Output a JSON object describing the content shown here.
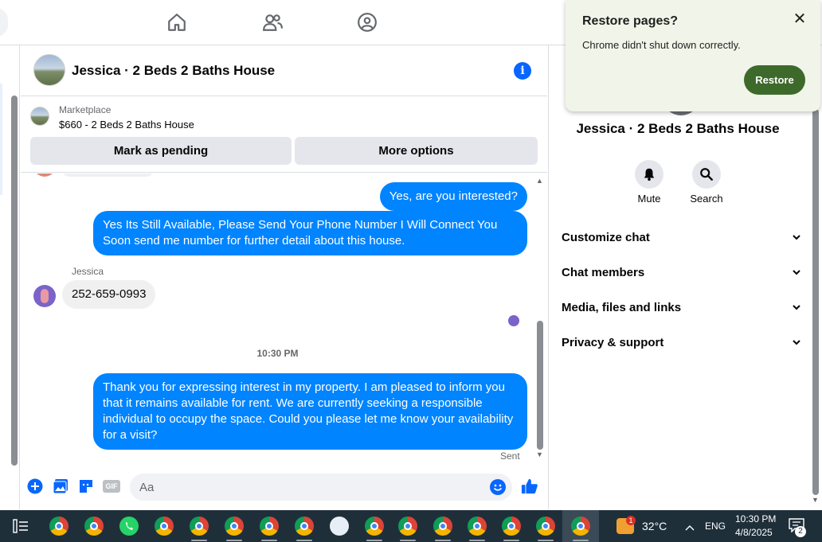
{
  "chat": {
    "title": "Jessica · 2 Beds 2 Baths House"
  },
  "marketplace": {
    "label": "Marketplace",
    "item": "$660 - 2 Beds 2 Baths House",
    "mark_pending_label": "Mark as pending",
    "more_options_label": "More options"
  },
  "messages": {
    "items": [
      {
        "direction": "out",
        "text": "Yes, are you interested?"
      },
      {
        "direction": "out",
        "text": "Yes Its Still Available, Please Send Your Phone Number I Will Connect You Soon send me number for further detail about this house."
      },
      {
        "direction": "in",
        "sender": "Jessica",
        "text": "252-659-0993"
      },
      {
        "direction": "out",
        "text": "Thank you for expressing interest in my property. I am pleased to inform you that it remains available for rent. We are currently seeking a responsible individual to occupy the space. Could you please let me know your availability for a visit?"
      }
    ],
    "timestamp": "10:30 PM",
    "status": "Sent"
  },
  "composer": {
    "placeholder": "Aa",
    "gif_label": "GIF"
  },
  "panel": {
    "name": "Jessica · 2 Beds 2 Baths House",
    "mute_label": "Mute",
    "search_label": "Search",
    "sections": [
      "Customize chat",
      "Chat members",
      "Media, files and links",
      "Privacy & support"
    ]
  },
  "popup": {
    "title": "Restore pages?",
    "message": "Chrome didn't shut down correctly.",
    "restore_label": "Restore",
    "close_glyph": "✕"
  },
  "taskbar": {
    "weather_badge": "1",
    "temperature": "32°C",
    "language": "ENG",
    "time": "10:30 PM",
    "date": "4/8/2025",
    "notification_count": "2"
  },
  "colors": {
    "outgoing_bubble": "#0084ff",
    "brand_blue": "#0866ff",
    "restore_button": "#3d6a2b",
    "taskbar": "#1f2f3a"
  }
}
